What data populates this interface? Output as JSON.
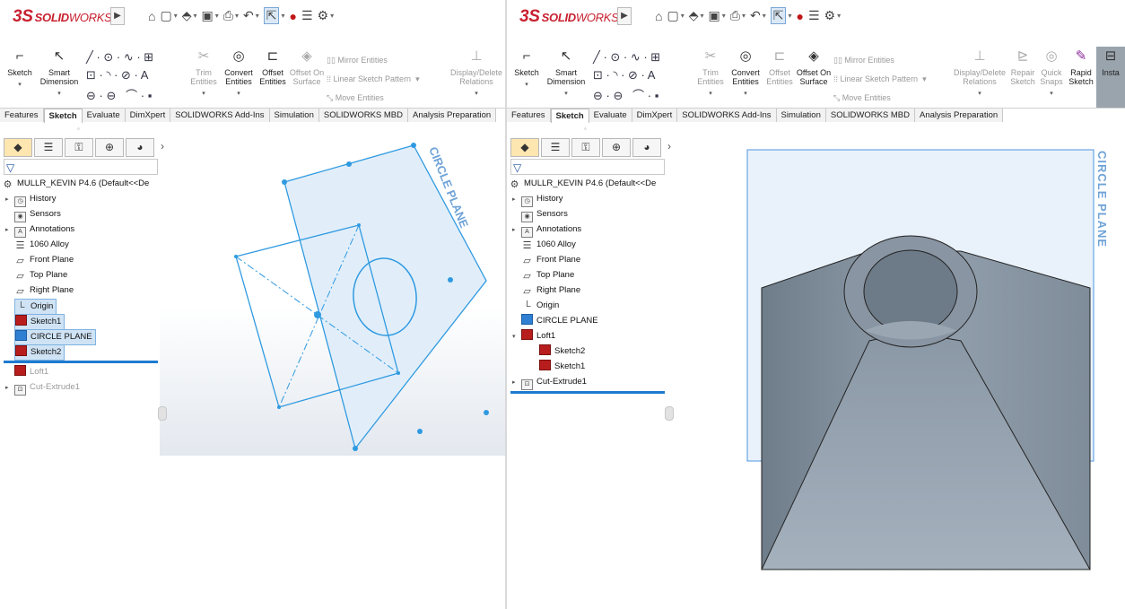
{
  "app": {
    "logo_prefix": "3S",
    "logo_brand": "SOLID",
    "logo_suffix": "WORKS",
    "menu_arrow": "▶"
  },
  "quick_access": [
    "⌂",
    "▢",
    "⬘",
    "▣",
    "⎙",
    "↶",
    "⇱",
    "●",
    "☰",
    "⚙"
  ],
  "ribbon_left": {
    "sketch": "Sketch",
    "smart_dimension": "Smart Dimension",
    "trim_entities": "Trim Entities",
    "convert_entities": "Convert Entities",
    "offset_entities": "Offset Entities",
    "offset_on_surface": "Offset On Surface",
    "mirror_entities": "Mirror Entities",
    "linear_sketch_pattern": "Linear Sketch Pattern",
    "move_entities": "Move Entities",
    "display_delete_relations": "Display/Delete Relations"
  },
  "ribbon_right": {
    "sketch": "Sketch",
    "smart_dimension": "Smart Dimension",
    "trim_entities": "Trim Entities",
    "convert_entities": "Convert Entities",
    "offset_entities": "Offset Entities",
    "offset_on_surface": "Offset On Surface",
    "mirror_entities": "Mirror Entities",
    "linear_sketch_pattern": "Linear Sketch Pattern",
    "move_entities": "Move Entities",
    "display_delete_relations": "Display/Delete Relations",
    "repair_sketch": "Repair Sketch",
    "quick_snaps": "Quick Snaps",
    "rapid_sketch": "Rapid Sketch",
    "insta": "Insta"
  },
  "tabs": [
    "Features",
    "Sketch",
    "Evaluate",
    "DimXpert",
    "SOLIDWORKS Add-Ins",
    "Simulation",
    "SOLIDWORKS MBD",
    "Analysis Preparation"
  ],
  "active_tab": "Sketch",
  "fm_tabs": [
    "◆",
    "☰",
    "⚿",
    "⊕",
    "◕"
  ],
  "fm_chevron": "›",
  "filter_icon": "▽",
  "part_name": "MULLR_KEVIN P4.6  (Default<<De",
  "left_tree": [
    {
      "label": "History"
    },
    {
      "label": "Sensors"
    },
    {
      "label": "Annotations"
    },
    {
      "label": "1060 Alloy"
    },
    {
      "label": "Front Plane"
    },
    {
      "label": "Top Plane"
    },
    {
      "label": "Right Plane"
    },
    {
      "label": "Origin"
    },
    {
      "label": "Sketch1"
    },
    {
      "label": "CIRCLE PLANE"
    },
    {
      "label": "Sketch2"
    },
    {
      "label": "Loft1"
    },
    {
      "label": "Cut-Extrude1"
    }
  ],
  "right_tree": [
    {
      "label": "History"
    },
    {
      "label": "Sensors"
    },
    {
      "label": "Annotations"
    },
    {
      "label": "1060 Alloy"
    },
    {
      "label": "Front Plane"
    },
    {
      "label": "Top Plane"
    },
    {
      "label": "Right Plane"
    },
    {
      "label": "Origin"
    },
    {
      "label": "CIRCLE PLANE"
    },
    {
      "label": "Loft1"
    },
    {
      "label": "Sketch2"
    },
    {
      "label": "Sketch1"
    },
    {
      "label": "Cut-Extrude1"
    }
  ],
  "viewport": {
    "plane_label": "CIRCLE PLANE",
    "accent": "#2f9ae0",
    "plane_fill": "#e1eefa",
    "solid_fill": "#8b98a6"
  }
}
